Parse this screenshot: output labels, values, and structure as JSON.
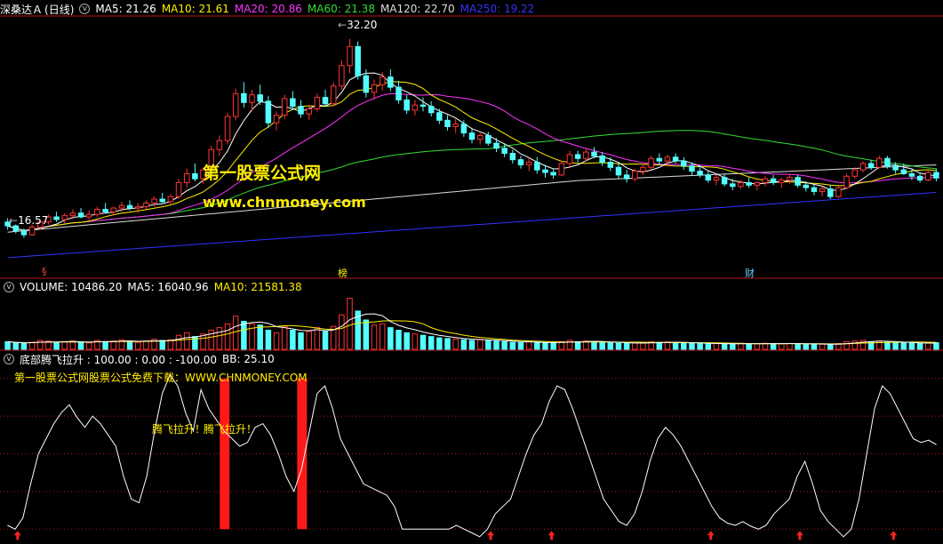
{
  "header": {
    "stock_name": "深桑达Ａ",
    "period": "(日线)",
    "ma": [
      {
        "label": "MA5: 21.26",
        "color": "#ffffff"
      },
      {
        "label": "MA10: 21.61",
        "color": "#ffee00"
      },
      {
        "label": "MA20: 20.86",
        "color": "#ff33ff"
      },
      {
        "label": "MA60: 21.38",
        "color": "#33dd33"
      },
      {
        "label": "MA120: 22.70",
        "color": "#dddddd"
      },
      {
        "label": "MA250: 19.22",
        "color": "#3333ff"
      }
    ]
  },
  "volume_header": {
    "title": "VOLUME: 10486.20",
    "ma5": "MA5: 16040.96",
    "ma10": "MA10: 21581.38"
  },
  "indicator_header": {
    "title": "底部腾飞拉升 : 100.00 : 0.00 : -100.00",
    "bb": "BB: 25.10"
  },
  "watermark": {
    "line1": "第一股票公式网",
    "line2": "www.chnmoney.com"
  },
  "ad_text": "第一股票公式网股票公式免费下载：WWW.CHNMONEY.COM",
  "price_annotations": {
    "high": "32.20",
    "low": "16.57"
  },
  "event_markers": [
    {
      "text": "§",
      "color": "#ff4444"
    },
    {
      "text": "榜",
      "color": "#ffee00"
    },
    {
      "text": "财",
      "color": "#66ccff"
    }
  ],
  "signal_label": "腾飞拉升！",
  "colors": {
    "up": "#ff3333",
    "down": "#54ffff",
    "grid": "#b01818"
  },
  "chart_data": {
    "type": "candlestick",
    "price": {
      "ylim": [
        14.5,
        34
      ],
      "high": 32.2,
      "low": 16.57,
      "candles": [
        [
          17.8,
          18.1,
          17.2,
          17.5
        ],
        [
          17.5,
          17.6,
          16.9,
          17.1
        ],
        [
          17.1,
          17.3,
          16.57,
          16.8
        ],
        [
          16.8,
          17.6,
          16.7,
          17.4
        ],
        [
          17.4,
          18.0,
          17.2,
          17.8
        ],
        [
          17.8,
          18.4,
          17.6,
          18.2
        ],
        [
          18.2,
          18.6,
          17.8,
          18.0
        ],
        [
          18.0,
          18.5,
          17.7,
          18.3
        ],
        [
          18.3,
          18.8,
          18.0,
          18.5
        ],
        [
          18.5,
          18.9,
          18.1,
          18.2
        ],
        [
          18.2,
          18.7,
          17.9,
          18.4
        ],
        [
          18.4,
          19.0,
          18.2,
          18.8
        ],
        [
          18.8,
          19.3,
          18.5,
          18.6
        ],
        [
          18.6,
          19.0,
          18.3,
          18.9
        ],
        [
          18.9,
          19.4,
          18.6,
          19.1
        ],
        [
          19.1,
          19.5,
          18.7,
          18.9
        ],
        [
          18.9,
          19.3,
          18.5,
          19.0
        ],
        [
          19.0,
          19.5,
          18.8,
          19.3
        ],
        [
          19.3,
          19.8,
          19.0,
          19.6
        ],
        [
          19.6,
          20.1,
          19.3,
          19.4
        ],
        [
          19.4,
          20.0,
          19.2,
          19.8
        ],
        [
          19.8,
          21.2,
          19.6,
          20.9
        ],
        [
          20.9,
          22.0,
          20.5,
          21.6
        ],
        [
          21.6,
          22.4,
          21.0,
          21.2
        ],
        [
          21.2,
          22.1,
          20.8,
          21.9
        ],
        [
          21.9,
          23.8,
          21.7,
          23.5
        ],
        [
          23.5,
          24.6,
          23.0,
          24.2
        ],
        [
          24.2,
          26.4,
          23.9,
          26.1
        ],
        [
          26.1,
          28.3,
          25.8,
          27.9
        ],
        [
          27.9,
          28.8,
          26.8,
          27.2
        ],
        [
          27.2,
          28.2,
          26.5,
          27.8
        ],
        [
          27.8,
          28.6,
          27.0,
          27.3
        ],
        [
          27.3,
          27.7,
          25.2,
          25.6
        ],
        [
          25.6,
          26.5,
          25.0,
          26.2
        ],
        [
          26.2,
          27.8,
          25.9,
          27.5
        ],
        [
          27.5,
          28.1,
          26.6,
          26.9
        ],
        [
          26.9,
          27.4,
          26.0,
          26.3
        ],
        [
          26.3,
          27.0,
          25.8,
          26.7
        ],
        [
          26.7,
          27.9,
          26.5,
          27.6
        ],
        [
          27.6,
          28.2,
          26.9,
          27.1
        ],
        [
          27.1,
          28.8,
          26.9,
          28.5
        ],
        [
          28.5,
          30.5,
          28.2,
          30.1
        ],
        [
          30.1,
          32.2,
          29.5,
          31.6
        ],
        [
          31.6,
          32.0,
          29.0,
          29.3
        ],
        [
          29.3,
          29.8,
          27.6,
          28.0
        ],
        [
          28.0,
          29.0,
          27.4,
          28.6
        ],
        [
          28.6,
          29.6,
          28.1,
          29.2
        ],
        [
          29.2,
          29.8,
          28.1,
          28.4
        ],
        [
          28.4,
          28.9,
          27.1,
          27.4
        ],
        [
          27.4,
          27.8,
          26.3,
          26.6
        ],
        [
          26.6,
          27.4,
          26.2,
          27.0
        ],
        [
          27.0,
          27.6,
          26.5,
          26.9
        ],
        [
          26.9,
          27.3,
          26.1,
          26.4
        ],
        [
          26.4,
          26.7,
          25.5,
          25.8
        ],
        [
          25.8,
          26.2,
          25.0,
          25.3
        ],
        [
          25.3,
          25.9,
          24.8,
          25.5
        ],
        [
          25.5,
          25.8,
          24.5,
          24.8
        ],
        [
          24.8,
          25.1,
          24.0,
          24.3
        ],
        [
          24.3,
          24.9,
          23.9,
          24.6
        ],
        [
          24.6,
          24.9,
          23.8,
          24.0
        ],
        [
          24.0,
          24.4,
          23.3,
          23.6
        ],
        [
          23.6,
          24.0,
          22.9,
          23.2
        ],
        [
          23.2,
          23.5,
          22.4,
          22.7
        ],
        [
          22.7,
          23.0,
          22.0,
          22.3
        ],
        [
          22.3,
          22.8,
          21.8,
          22.5
        ],
        [
          22.5,
          22.9,
          21.6,
          21.9
        ],
        [
          21.9,
          22.3,
          21.3,
          21.7
        ],
        [
          21.7,
          22.0,
          21.2,
          21.5
        ],
        [
          21.5,
          22.6,
          21.4,
          22.4
        ],
        [
          22.4,
          23.4,
          22.2,
          23.1
        ],
        [
          23.1,
          23.4,
          22.5,
          22.8
        ],
        [
          22.8,
          23.6,
          22.6,
          23.3
        ],
        [
          23.3,
          23.7,
          22.8,
          23.0
        ],
        [
          23.0,
          23.3,
          22.2,
          22.5
        ],
        [
          22.5,
          22.9,
          21.8,
          22.1
        ],
        [
          22.1,
          22.4,
          21.2,
          21.5
        ],
        [
          21.5,
          21.9,
          20.9,
          21.2
        ],
        [
          21.2,
          22.0,
          21.0,
          21.8
        ],
        [
          21.8,
          22.4,
          21.5,
          22.1
        ],
        [
          22.1,
          23.0,
          21.9,
          22.8
        ],
        [
          22.8,
          23.2,
          22.3,
          22.6
        ],
        [
          22.6,
          23.1,
          22.2,
          22.9
        ],
        [
          22.9,
          23.2,
          22.4,
          22.6
        ],
        [
          22.6,
          22.9,
          21.9,
          22.2
        ],
        [
          22.2,
          22.5,
          21.5,
          21.8
        ],
        [
          21.8,
          22.2,
          21.3,
          21.5
        ],
        [
          21.5,
          21.8,
          20.9,
          21.1
        ],
        [
          21.1,
          21.5,
          20.7,
          21.3
        ],
        [
          21.3,
          21.6,
          20.6,
          20.8
        ],
        [
          20.8,
          21.2,
          20.3,
          20.6
        ],
        [
          20.6,
          21.1,
          20.4,
          20.9
        ],
        [
          20.9,
          21.3,
          20.5,
          20.7
        ],
        [
          20.7,
          21.0,
          20.3,
          20.9
        ],
        [
          20.9,
          21.4,
          20.6,
          21.2
        ],
        [
          21.2,
          21.5,
          20.7,
          20.9
        ],
        [
          20.9,
          21.3,
          20.5,
          21.1
        ],
        [
          21.1,
          21.6,
          20.8,
          21.3
        ],
        [
          21.3,
          21.5,
          20.5,
          20.7
        ],
        [
          20.7,
          21.0,
          20.2,
          20.5
        ],
        [
          20.5,
          20.8,
          19.9,
          20.2
        ],
        [
          20.2,
          20.6,
          19.8,
          20.4
        ],
        [
          20.4,
          20.7,
          19.6,
          19.8
        ],
        [
          19.8,
          20.6,
          19.7,
          20.5
        ],
        [
          20.5,
          21.6,
          20.4,
          21.4
        ],
        [
          21.4,
          22.1,
          21.2,
          21.9
        ],
        [
          21.9,
          22.6,
          21.7,
          22.4
        ],
        [
          22.4,
          22.7,
          21.9,
          22.1
        ],
        [
          22.1,
          23.0,
          22.0,
          22.8
        ],
        [
          22.8,
          23.0,
          22.0,
          22.2
        ],
        [
          22.2,
          22.5,
          21.6,
          21.9
        ],
        [
          21.9,
          22.4,
          21.5,
          21.6
        ],
        [
          21.6,
          22.0,
          21.1,
          21.4
        ],
        [
          21.4,
          21.7,
          20.9,
          21.1
        ],
        [
          21.1,
          21.9,
          21.0,
          21.7
        ],
        [
          21.7,
          22.0,
          21.0,
          21.26
        ]
      ]
    },
    "volume": {
      "ylim": [
        0,
        85000
      ],
      "values": [
        12000,
        10000,
        9000,
        11000,
        14000,
        13000,
        10000,
        12000,
        13000,
        11000,
        10000,
        14000,
        12000,
        13000,
        15000,
        12000,
        11000,
        13000,
        16000,
        14000,
        15000,
        22000,
        26000,
        20000,
        24000,
        30000,
        34000,
        40000,
        52000,
        44000,
        40000,
        38000,
        30000,
        26000,
        36000,
        30000,
        26000,
        28000,
        34000,
        28000,
        36000,
        54000,
        80000,
        60000,
        46000,
        38000,
        40000,
        34000,
        30000,
        26000,
        24000,
        22000,
        20000,
        18000,
        17000,
        16000,
        15000,
        14000,
        15000,
        14000,
        13000,
        12000,
        11000,
        10500,
        12000,
        11000,
        10000,
        9500,
        12000,
        14000,
        12000,
        13000,
        12000,
        11000,
        10000,
        9500,
        9000,
        10000,
        10500,
        12000,
        11000,
        11500,
        10500,
        10000,
        9500,
        9000,
        8500,
        9000,
        8500,
        8000,
        9000,
        8500,
        9000,
        9500,
        9000,
        8800,
        9200,
        8500,
        8000,
        7800,
        8000,
        7600,
        9000,
        12000,
        13000,
        14000,
        12000,
        13000,
        11000,
        10500,
        10000,
        9500,
        9000,
        10000,
        10486
      ]
    },
    "indicator": {
      "ylim": [
        -115,
        115
      ],
      "levels": [
        100,
        50,
        0,
        -50,
        -100
      ],
      "values": [
        -95,
        -100,
        -85,
        -40,
        0,
        20,
        40,
        55,
        65,
        48,
        35,
        50,
        40,
        25,
        10,
        -30,
        -60,
        -65,
        -30,
        30,
        80,
        105,
        90,
        55,
        30,
        85,
        60,
        45,
        30,
        20,
        10,
        15,
        35,
        40,
        25,
        0,
        -30,
        -50,
        -20,
        30,
        80,
        90,
        60,
        20,
        0,
        -20,
        -40,
        -45,
        -50,
        -55,
        -70,
        -100,
        -100,
        -100,
        -100,
        -100,
        -100,
        -100,
        -95,
        -100,
        -105,
        -110,
        -100,
        -80,
        -70,
        -60,
        -30,
        0,
        25,
        40,
        70,
        90,
        85,
        60,
        30,
        0,
        -30,
        -60,
        -75,
        -90,
        -95,
        -80,
        -50,
        -10,
        20,
        35,
        25,
        10,
        -10,
        -30,
        -50,
        -70,
        -85,
        -92,
        -95,
        -90,
        -96,
        -100,
        -95,
        -80,
        -70,
        -60,
        -30,
        -10,
        -40,
        -75,
        -90,
        -100,
        -110,
        -100,
        -60,
        0,
        60,
        90,
        80,
        60,
        40,
        20,
        15,
        18,
        12
      ],
      "rally_signals": [
        28,
        38
      ],
      "bottom_signals": [
        3,
        104,
        117,
        151,
        170,
        190
      ],
      "signal_min": [
        -100,
        100
      ]
    }
  }
}
